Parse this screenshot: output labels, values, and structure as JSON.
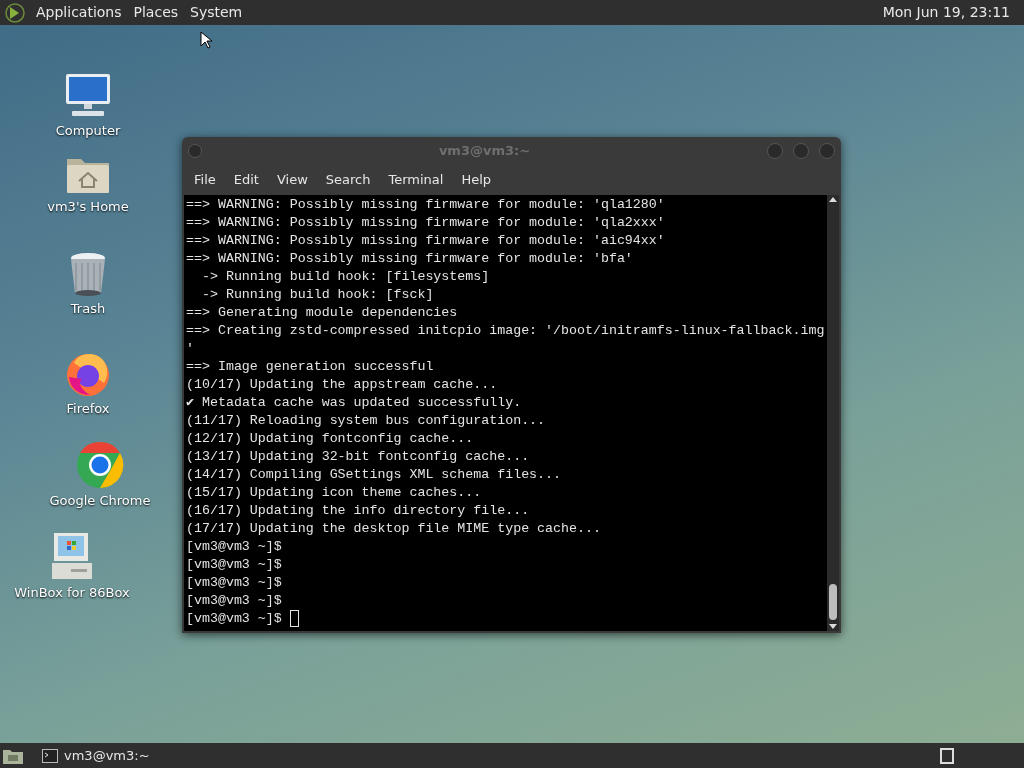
{
  "top_panel": {
    "menus": [
      "Applications",
      "Places",
      "System"
    ],
    "clock": "Mon Jun 19, 23:11"
  },
  "desktop_icons": [
    {
      "kind": "computer",
      "label": "Computer"
    },
    {
      "kind": "home",
      "label": "vm3's Home"
    },
    {
      "kind": "trash",
      "label": "Trash"
    },
    {
      "kind": "firefox",
      "label": "Firefox"
    },
    {
      "kind": "chrome",
      "label": "Google Chrome"
    },
    {
      "kind": "winbox",
      "label": "WinBox for 86Box"
    }
  ],
  "terminal": {
    "title": "vm3@vm3:~",
    "menus": [
      "File",
      "Edit",
      "View",
      "Search",
      "Terminal",
      "Help"
    ],
    "lines": [
      "==> WARNING: Possibly missing firmware for module: 'qla1280'",
      "==> WARNING: Possibly missing firmware for module: 'qla2xxx'",
      "==> WARNING: Possibly missing firmware for module: 'aic94xx'",
      "==> WARNING: Possibly missing firmware for module: 'bfa'",
      "  -> Running build hook: [filesystems]",
      "  -> Running build hook: [fsck]",
      "==> Generating module dependencies",
      "==> Creating zstd-compressed initcpio image: '/boot/initramfs-linux-fallback.img",
      "'",
      "==> Image generation successful",
      "(10/17) Updating the appstream cache...",
      "✔ Metadata cache was updated successfully.",
      "(11/17) Reloading system bus configuration...",
      "(12/17) Updating fontconfig cache...",
      "(13/17) Updating 32-bit fontconfig cache...",
      "(14/17) Compiling GSettings XML schema files...",
      "(15/17) Updating icon theme caches...",
      "(16/17) Updating the info directory file...",
      "(17/17) Updating the desktop file MIME type cache...",
      "[vm3@vm3 ~]$",
      "[vm3@vm3 ~]$",
      "[vm3@vm3 ~]$",
      "[vm3@vm3 ~]$",
      "[vm3@vm3 ~]$ "
    ]
  },
  "taskbar": {
    "windows": [
      {
        "label": "vm3@vm3:~",
        "selected": false
      }
    ]
  }
}
